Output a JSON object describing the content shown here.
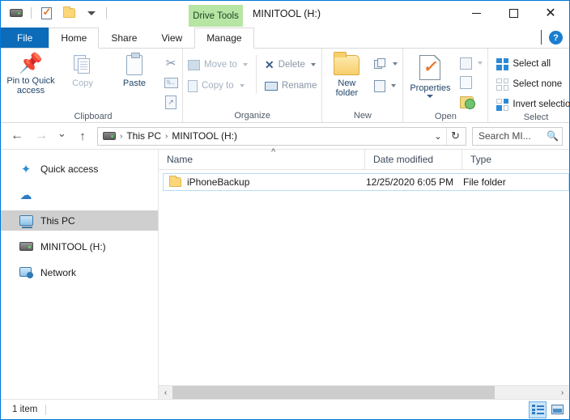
{
  "window": {
    "title": "MINITOOL (H:)",
    "contextual_tab_banner": "Drive Tools",
    "accent_color": "#0078d7",
    "banner_color": "#b7e5a4"
  },
  "quick_access_toolbar": {
    "items": [
      {
        "name": "drive-icon",
        "tooltip": "MINITOOL (H:)"
      },
      {
        "name": "properties-icon",
        "tooltip": "Properties"
      },
      {
        "name": "new-folder-icon",
        "tooltip": "New folder"
      },
      {
        "name": "customize-caret-icon",
        "tooltip": "Customize Quick Access Toolbar"
      }
    ]
  },
  "window_controls": {
    "minimize": "–",
    "maximize": "□",
    "close": "✕"
  },
  "tabs": [
    {
      "label": "File",
      "state": "file"
    },
    {
      "label": "Home",
      "state": "active"
    },
    {
      "label": "Share",
      "state": "normal"
    },
    {
      "label": "View",
      "state": "normal"
    },
    {
      "label": "Manage",
      "state": "contextual"
    }
  ],
  "tab_row_right": {
    "collapse_ribbon": "^",
    "help": "?"
  },
  "ribbon": {
    "groups": [
      {
        "label": "Clipboard",
        "big_buttons": [
          {
            "label": "Pin to Quick\naccess",
            "icon": "pin-icon",
            "disabled": false
          },
          {
            "label": "Copy",
            "icon": "copy-icon",
            "disabled": true
          },
          {
            "label": "Paste",
            "icon": "paste-icon",
            "disabled": false
          }
        ],
        "small_buttons": [
          {
            "label": "Cut",
            "icon": "scissors-icon",
            "disabled": true
          },
          {
            "label": "Copy path",
            "icon": "copy-path-icon",
            "disabled": true
          },
          {
            "label": "Paste shortcut",
            "icon": "paste-shortcut-icon",
            "disabled": true
          }
        ]
      },
      {
        "label": "Organize",
        "small_buttons": [
          {
            "label": "Move to",
            "icon": "move-to-icon",
            "disabled": true,
            "has_caret": true
          },
          {
            "label": "Copy to",
            "icon": "copy-to-icon",
            "disabled": true,
            "has_caret": true
          },
          {
            "label": "Delete",
            "icon": "delete-x-icon",
            "disabled": false,
            "has_caret": true
          },
          {
            "label": "Rename",
            "icon": "rename-icon",
            "disabled": false,
            "has_caret": false
          }
        ]
      },
      {
        "label": "New",
        "big_buttons": [
          {
            "label": "New\nfolder",
            "icon": "new-folder-icon",
            "disabled": false
          }
        ],
        "small_buttons": [
          {
            "label": "New item",
            "icon": "new-item-icon",
            "disabled": false,
            "has_caret": true
          },
          {
            "label": "Easy access",
            "icon": "easy-access-icon",
            "disabled": false,
            "has_caret": true
          }
        ]
      },
      {
        "label": "Open",
        "big_buttons": [
          {
            "label": "Properties",
            "icon": "properties-icon",
            "disabled": false,
            "has_caret": true
          }
        ],
        "small_buttons": [
          {
            "label": "Open",
            "icon": "open-icon",
            "disabled": true,
            "has_caret": true
          },
          {
            "label": "Edit",
            "icon": "edit-icon",
            "disabled": true,
            "has_caret": false
          },
          {
            "label": "History",
            "icon": "history-icon",
            "disabled": false,
            "has_caret": false
          }
        ]
      },
      {
        "label": "Select",
        "small_buttons": [
          {
            "label": "Select all",
            "icon": "select-all-icon",
            "disabled": false
          },
          {
            "label": "Select none",
            "icon": "select-none-icon",
            "disabled": false
          },
          {
            "label": "Invert selection",
            "icon": "invert-selection-icon",
            "disabled": false
          }
        ]
      }
    ]
  },
  "address_bar": {
    "back": "←",
    "forward": "→",
    "recent_locations": "⌄",
    "up": "↑",
    "breadcrumb": {
      "drive_icon": "drive-icon",
      "parts": [
        "This PC",
        "MINITOOL (H:)"
      ],
      "separator": "›"
    },
    "dropdown_caret": "⌄",
    "refresh": "↻"
  },
  "search": {
    "value": "Search MI...",
    "placeholder": "Search MINITOOL (H:)",
    "icon": "search-icon"
  },
  "navigation_pane": {
    "items": [
      {
        "label": "Quick access",
        "icon": "star-icon",
        "selected": false
      },
      {
        "label": "",
        "icon": "onedrive-cloud-icon",
        "selected": false
      },
      {
        "label": "This PC",
        "icon": "computer-icon",
        "selected": true
      },
      {
        "label": "MINITOOL (H:)",
        "icon": "drive-icon",
        "selected": false
      },
      {
        "label": "Network",
        "icon": "network-icon",
        "selected": false
      }
    ]
  },
  "file_list": {
    "columns": [
      {
        "label": "Name",
        "sorted": "ascending"
      },
      {
        "label": "Date modified",
        "sorted": ""
      },
      {
        "label": "Type",
        "sorted": ""
      }
    ],
    "rows": [
      {
        "name": "iPhoneBackup",
        "date_modified": "12/25/2020 6:05 PM",
        "type": "File folder",
        "icon": "folder-icon"
      }
    ]
  },
  "scrollbar": {
    "left_arrow": "‹",
    "right_arrow": "›"
  },
  "status_bar": {
    "item_count": "1 item",
    "view_buttons": [
      {
        "name": "details-view-button",
        "active": true
      },
      {
        "name": "large-icons-view-button",
        "active": false
      }
    ]
  }
}
